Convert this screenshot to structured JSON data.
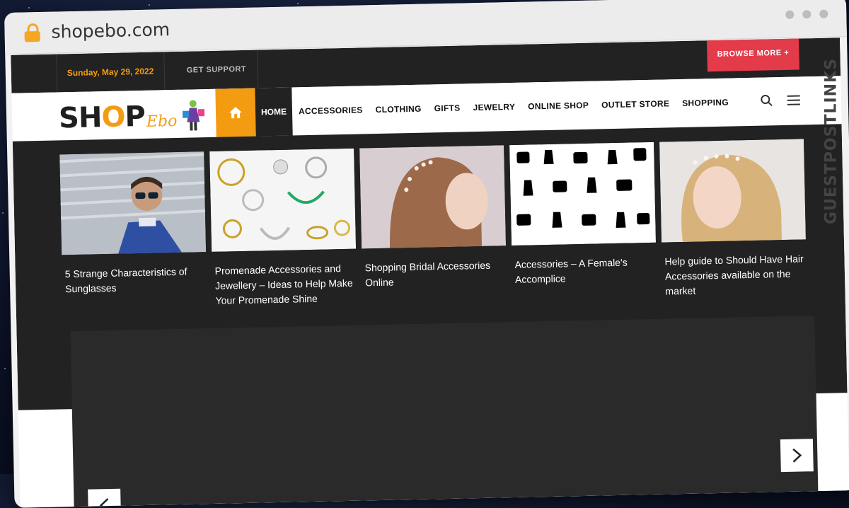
{
  "browser": {
    "url": "shopebo.com"
  },
  "topbar": {
    "date": "Sunday, May 29, 2022",
    "support": "GET SUPPORT",
    "browse_more": "BROWSE MORE +"
  },
  "logo": {
    "main_pre": "SH",
    "main_o": "O",
    "main_post": "P",
    "script": "Ebo"
  },
  "nav": {
    "home": "HOME",
    "items": [
      "ACCESSORIES",
      "CLOTHING",
      "GIFTS",
      "JEWELRY",
      "ONLINE SHOP",
      "OUTLET STORE",
      "SHOPPING"
    ]
  },
  "cards": [
    {
      "title": "5 Strange Characteristics of Sunglasses"
    },
    {
      "title": "Promenade Accessories and Jewellery – Ideas to Help Make Your Promenade Shine"
    },
    {
      "title": "Shopping Bridal Accessories Online"
    },
    {
      "title": "Accessories – A Female's Accomplice"
    },
    {
      "title": "Help guide to Should Have Hair Accessories available on the market"
    }
  ],
  "watermark": "GUESTPOSTLINKS",
  "colors": {
    "accent": "#f39c12",
    "browse": "#e33b4a",
    "dark": "#222222"
  }
}
